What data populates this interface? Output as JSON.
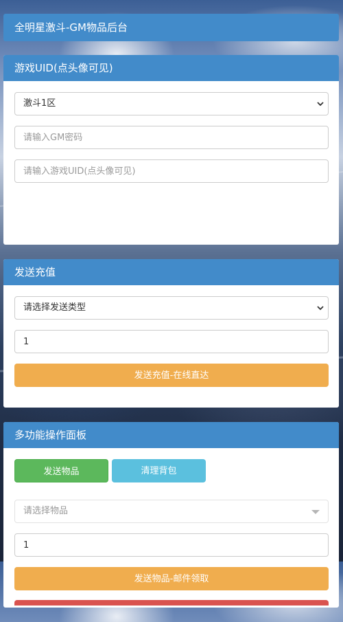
{
  "header": {
    "title": "全明星激斗-GM物品后台"
  },
  "uid_panel": {
    "heading": "游戏UID(点头像可见)",
    "server_select": {
      "selected": "激斗1区"
    },
    "gm_password": {
      "placeholder": "请输入GM密码",
      "value": ""
    },
    "game_uid": {
      "placeholder": "请输入游戏UID(点头像可见)",
      "value": ""
    }
  },
  "recharge_panel": {
    "heading": "发送充值",
    "type_select": {
      "selected": "请选择发送类型"
    },
    "amount": {
      "value": "1"
    },
    "submit_label": "发送充值-在线直达"
  },
  "multi_panel": {
    "heading": "多功能操作面板",
    "send_items_label": "发送物品",
    "clear_bag_label": "清理背包",
    "item_select": {
      "selected": "请选择物品"
    },
    "quantity": {
      "value": "1"
    },
    "submit_label": "发送物品-邮件领取"
  },
  "colors": {
    "primary": "#428bca",
    "warning": "#f0ad4e",
    "success": "#5cb85c",
    "info": "#5bc0de",
    "danger": "#d9534f"
  }
}
